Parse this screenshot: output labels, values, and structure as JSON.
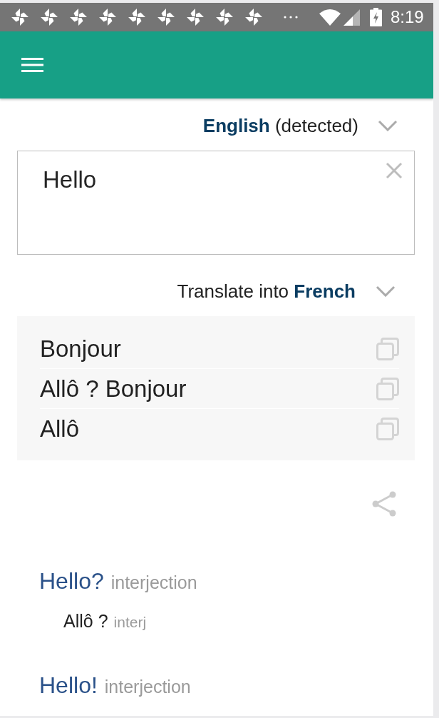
{
  "status_bar": {
    "notifications": [
      {
        "kind": "pinwheel"
      },
      {
        "kind": "pinwheel"
      },
      {
        "kind": "pinwheel"
      },
      {
        "kind": "pinwheel"
      },
      {
        "kind": "pinwheel"
      },
      {
        "kind": "pinwheel"
      },
      {
        "kind": "pinwheel"
      },
      {
        "kind": "pinwheel"
      },
      {
        "kind": "pinwheel"
      }
    ],
    "more_notifications": true,
    "battery_charging": true,
    "time": "8:19"
  },
  "source": {
    "language_label": "**English** (detected)",
    "input": {
      "value": "Hello"
    }
  },
  "target": {
    "language_label": "Translate into **French**"
  },
  "translations": [
    {
      "text": "Bonjour"
    },
    {
      "text": "Allô ? Bonjour"
    },
    {
      "text": "Allô"
    }
  ],
  "dictionary": [
    {
      "headword": "Hello?",
      "part_of_speech": "interjection",
      "senses": [
        {
          "text": "Allô ?",
          "part_of_speech": "interj"
        }
      ]
    },
    {
      "headword": "Hello!",
      "part_of_speech": "interjection"
    }
  ]
}
